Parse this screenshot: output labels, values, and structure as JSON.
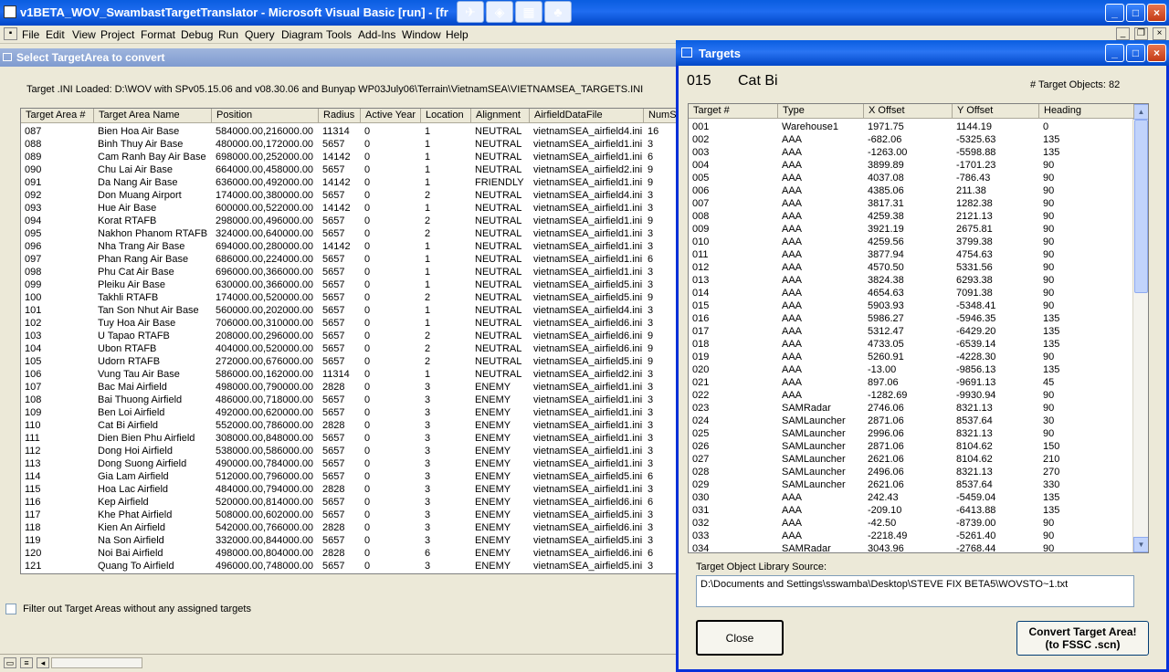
{
  "app": {
    "title": "v1BETA_WOV_SwambastTargetTranslator - Microsoft Visual Basic [run] - [fr",
    "menu": [
      "File",
      "Edit",
      "View",
      "Project",
      "Format",
      "Debug",
      "Run",
      "Query",
      "Diagram",
      "Tools",
      "Add-Ins",
      "Window",
      "Help"
    ]
  },
  "main_window": {
    "title": "Select TargetArea to convert",
    "loaded_text": "Target .INI Loaded: D:\\WOV with SPv05.15.06 and  v08.30.06 and Bunyap WP03July06\\Terrain\\VietnamSEA\\VIETNAMSEA_TARGETS.INI",
    "filter_label": "Filter out Target Areas without any assigned targets",
    "columns": [
      "Target Area #",
      "Target Area Name",
      "Position",
      "Radius",
      "Active Year",
      "Location",
      "Alignment",
      "AirfieldDataFile",
      "NumS"
    ],
    "rows": [
      [
        "087",
        "Bien Hoa Air Base",
        "584000.00,216000.00",
        "11314",
        "0",
        "1",
        "NEUTRAL",
        "vietnamSEA_airfield4.ini",
        "16"
      ],
      [
        "088",
        "Binh Thuy Air Base",
        "480000.00,172000.00",
        "5657",
        "0",
        "1",
        "NEUTRAL",
        "vietnamSEA_airfield1.ini",
        "3"
      ],
      [
        "089",
        "Cam Ranh Bay Air Base",
        "698000.00,252000.00",
        "14142",
        "0",
        "1",
        "NEUTRAL",
        "vietnamSEA_airfield1.ini",
        "6"
      ],
      [
        "090",
        "Chu Lai Air Base",
        "664000.00,458000.00",
        "5657",
        "0",
        "1",
        "NEUTRAL",
        "vietnamSEA_airfield2.ini",
        "9"
      ],
      [
        "091",
        "Da Nang Air Base",
        "636000.00,492000.00",
        "14142",
        "0",
        "1",
        "FRIENDLY",
        "vietnamSEA_airfield1.ini",
        "9"
      ],
      [
        "092",
        "Don Muang Airport",
        "174000.00,380000.00",
        "5657",
        "0",
        "2",
        "NEUTRAL",
        "vietnamSEA_airfield4.ini",
        "3"
      ],
      [
        "093",
        "Hue Air Base",
        "600000.00,522000.00",
        "14142",
        "0",
        "1",
        "NEUTRAL",
        "vietnamSEA_airfield1.ini",
        "3"
      ],
      [
        "094",
        "Korat RTAFB",
        "298000.00,496000.00",
        "5657",
        "0",
        "2",
        "NEUTRAL",
        "vietnamSEA_airfield1.ini",
        "9"
      ],
      [
        "095",
        "Nakhon Phanom RTAFB",
        "324000.00,640000.00",
        "5657",
        "0",
        "2",
        "NEUTRAL",
        "vietnamSEA_airfield1.ini",
        "3"
      ],
      [
        "096",
        "Nha Trang Air Base",
        "694000.00,280000.00",
        "14142",
        "0",
        "1",
        "NEUTRAL",
        "vietnamSEA_airfield1.ini",
        "3"
      ],
      [
        "097",
        "Phan Rang Air Base",
        "686000.00,224000.00",
        "5657",
        "0",
        "1",
        "NEUTRAL",
        "vietnamSEA_airfield1.ini",
        "6"
      ],
      [
        "098",
        "Phu Cat Air Base",
        "696000.00,366000.00",
        "5657",
        "0",
        "1",
        "NEUTRAL",
        "vietnamSEA_airfield1.ini",
        "3"
      ],
      [
        "099",
        "Pleiku Air Base",
        "630000.00,366000.00",
        "5657",
        "0",
        "1",
        "NEUTRAL",
        "vietnamSEA_airfield5.ini",
        "3"
      ],
      [
        "100",
        "Takhli RTAFB",
        "174000.00,520000.00",
        "5657",
        "0",
        "2",
        "NEUTRAL",
        "vietnamSEA_airfield5.ini",
        "9"
      ],
      [
        "101",
        "Tan Son Nhut Air Base",
        "560000.00,202000.00",
        "5657",
        "0",
        "1",
        "NEUTRAL",
        "vietnamSEA_airfield4.ini",
        "3"
      ],
      [
        "102",
        "Tuy Hoa Air Base",
        "706000.00,310000.00",
        "5657",
        "0",
        "1",
        "NEUTRAL",
        "vietnamSEA_airfield6.ini",
        "3"
      ],
      [
        "103",
        "U Tapao RTAFB",
        "208000.00,296000.00",
        "5657",
        "0",
        "2",
        "NEUTRAL",
        "vietnamSEA_airfield6.ini",
        "9"
      ],
      [
        "104",
        "Ubon RTAFB",
        "404000.00,520000.00",
        "5657",
        "0",
        "2",
        "NEUTRAL",
        "vietnamSEA_airfield6.ini",
        "9"
      ],
      [
        "105",
        "Udorn RTAFB",
        "272000.00,676000.00",
        "5657",
        "0",
        "2",
        "NEUTRAL",
        "vietnamSEA_airfield5.ini",
        "9"
      ],
      [
        "106",
        "Vung Tau Air Base",
        "586000.00,162000.00",
        "11314",
        "0",
        "1",
        "NEUTRAL",
        "vietnamSEA_airfield2.ini",
        "3"
      ],
      [
        "107",
        "Bac Mai Airfield",
        "498000.00,790000.00",
        "2828",
        "0",
        "3",
        "ENEMY",
        "vietnamSEA_airfield1.ini",
        "3"
      ],
      [
        "108",
        "Bai Thuong Airfield",
        "486000.00,718000.00",
        "5657",
        "0",
        "3",
        "ENEMY",
        "vietnamSEA_airfield1.ini",
        "3"
      ],
      [
        "109",
        "Ben Loi Airfield",
        "492000.00,620000.00",
        "5657",
        "0",
        "3",
        "ENEMY",
        "vietnamSEA_airfield1.ini",
        "3"
      ],
      [
        "110",
        "Cat Bi Airfield",
        "552000.00,786000.00",
        "2828",
        "0",
        "3",
        "ENEMY",
        "vietnamSEA_airfield1.ini",
        "3"
      ],
      [
        "111",
        "Dien Bien Phu Airfield",
        "308000.00,848000.00",
        "5657",
        "0",
        "3",
        "ENEMY",
        "vietnamSEA_airfield1.ini",
        "3"
      ],
      [
        "112",
        "Dong Hoi Airfield",
        "538000.00,586000.00",
        "5657",
        "0",
        "3",
        "ENEMY",
        "vietnamSEA_airfield1.ini",
        "3"
      ],
      [
        "113",
        "Dong Suong Airfield",
        "490000.00,784000.00",
        "5657",
        "0",
        "3",
        "ENEMY",
        "vietnamSEA_airfield1.ini",
        "3"
      ],
      [
        "114",
        "Gia Lam Airfield",
        "512000.00,796000.00",
        "5657",
        "0",
        "3",
        "ENEMY",
        "vietnamSEA_airfield5.ini",
        "6"
      ],
      [
        "115",
        "Hoa Lac Airfield",
        "484000.00,794000.00",
        "2828",
        "0",
        "3",
        "ENEMY",
        "vietnamSEA_airfield1.ini",
        "3"
      ],
      [
        "116",
        "Kep Airfield",
        "520000.00,814000.00",
        "5657",
        "0",
        "3",
        "ENEMY",
        "vietnamSEA_airfield6.ini",
        "6"
      ],
      [
        "117",
        "Khe Phat Airfield",
        "508000.00,602000.00",
        "5657",
        "0",
        "3",
        "ENEMY",
        "vietnamSEA_airfield5.ini",
        "3"
      ],
      [
        "118",
        "Kien An Airfield",
        "542000.00,766000.00",
        "2828",
        "0",
        "3",
        "ENEMY",
        "vietnamSEA_airfield6.ini",
        "3"
      ],
      [
        "119",
        "Na Son Airfield",
        "332000.00,844000.00",
        "5657",
        "0",
        "3",
        "ENEMY",
        "vietnamSEA_airfield5.ini",
        "3"
      ],
      [
        "120",
        "Noi Bai Airfield",
        "498000.00,804000.00",
        "2828",
        "0",
        "6",
        "ENEMY",
        "vietnamSEA_airfield6.ini",
        "6"
      ],
      [
        "121",
        "Quang To Airfield",
        "496000.00,748000.00",
        "5657",
        "0",
        "3",
        "ENEMY",
        "vietnamSEA_airfield5.ini",
        "3"
      ]
    ]
  },
  "targets_dialog": {
    "title": "Targets",
    "area_id": "015",
    "area_name": "Cat Bi",
    "count_text": "# Target Objects:  82",
    "columns": [
      "Target #",
      "Type",
      "X Offset",
      "Y Offset",
      "Heading"
    ],
    "rows": [
      [
        "001",
        "Warehouse1",
        "1971.75",
        "1144.19",
        "0"
      ],
      [
        "002",
        "AAA",
        "-682.06",
        "-5325.63",
        "135"
      ],
      [
        "003",
        "AAA",
        "-1263.00",
        "-5598.88",
        "135"
      ],
      [
        "004",
        "AAA",
        "3899.89",
        "-1701.23",
        "90"
      ],
      [
        "005",
        "AAA",
        "4037.08",
        "-786.43",
        "90"
      ],
      [
        "006",
        "AAA",
        "4385.06",
        "211.38",
        "90"
      ],
      [
        "007",
        "AAA",
        "3817.31",
        "1282.38",
        "90"
      ],
      [
        "008",
        "AAA",
        "4259.38",
        "2121.13",
        "90"
      ],
      [
        "009",
        "AAA",
        "3921.19",
        "2675.81",
        "90"
      ],
      [
        "010",
        "AAA",
        "4259.56",
        "3799.38",
        "90"
      ],
      [
        "011",
        "AAA",
        "3877.94",
        "4754.63",
        "90"
      ],
      [
        "012",
        "AAA",
        "4570.50",
        "5331.56",
        "90"
      ],
      [
        "013",
        "AAA",
        "3824.38",
        "6293.38",
        "90"
      ],
      [
        "014",
        "AAA",
        "4654.63",
        "7091.38",
        "90"
      ],
      [
        "015",
        "AAA",
        "5903.93",
        "-5348.41",
        "90"
      ],
      [
        "016",
        "AAA",
        "5986.27",
        "-5946.35",
        "135"
      ],
      [
        "017",
        "AAA",
        "5312.47",
        "-6429.20",
        "135"
      ],
      [
        "018",
        "AAA",
        "4733.05",
        "-6539.14",
        "135"
      ],
      [
        "019",
        "AAA",
        "5260.91",
        "-4228.30",
        "90"
      ],
      [
        "020",
        "AAA",
        "-13.00",
        "-9856.13",
        "135"
      ],
      [
        "021",
        "AAA",
        "897.06",
        "-9691.13",
        "45"
      ],
      [
        "022",
        "AAA",
        "-1282.69",
        "-9930.94",
        "90"
      ],
      [
        "023",
        "SAMRadar",
        "2746.06",
        "8321.13",
        "90"
      ],
      [
        "024",
        "SAMLauncher",
        "2871.06",
        "8537.64",
        "30"
      ],
      [
        "025",
        "SAMLauncher",
        "2996.06",
        "8321.13",
        "90"
      ],
      [
        "026",
        "SAMLauncher",
        "2871.06",
        "8104.62",
        "150"
      ],
      [
        "027",
        "SAMLauncher",
        "2621.06",
        "8104.62",
        "210"
      ],
      [
        "028",
        "SAMLauncher",
        "2496.06",
        "8321.13",
        "270"
      ],
      [
        "029",
        "SAMLauncher",
        "2621.06",
        "8537.64",
        "330"
      ],
      [
        "030",
        "AAA",
        "242.43",
        "-5459.04",
        "135"
      ],
      [
        "031",
        "AAA",
        "-209.10",
        "-6413.88",
        "135"
      ],
      [
        "032",
        "AAA",
        "-42.50",
        "-8739.00",
        "90"
      ],
      [
        "033",
        "AAA",
        "-2218.49",
        "-5261.40",
        "90"
      ],
      [
        "034",
        "SAMRadar",
        "3043.96",
        "-2768.44",
        "90"
      ]
    ],
    "source_label": "Target Object Library Source:",
    "source_path": "D:\\Documents and Settings\\sswamba\\Desktop\\STEVE FIX BETA5\\WOVSTO~1.txt",
    "close_label": "Close",
    "convert_label_1": "Convert Target Area!",
    "convert_label_2": "(to FSSC .scn)"
  }
}
